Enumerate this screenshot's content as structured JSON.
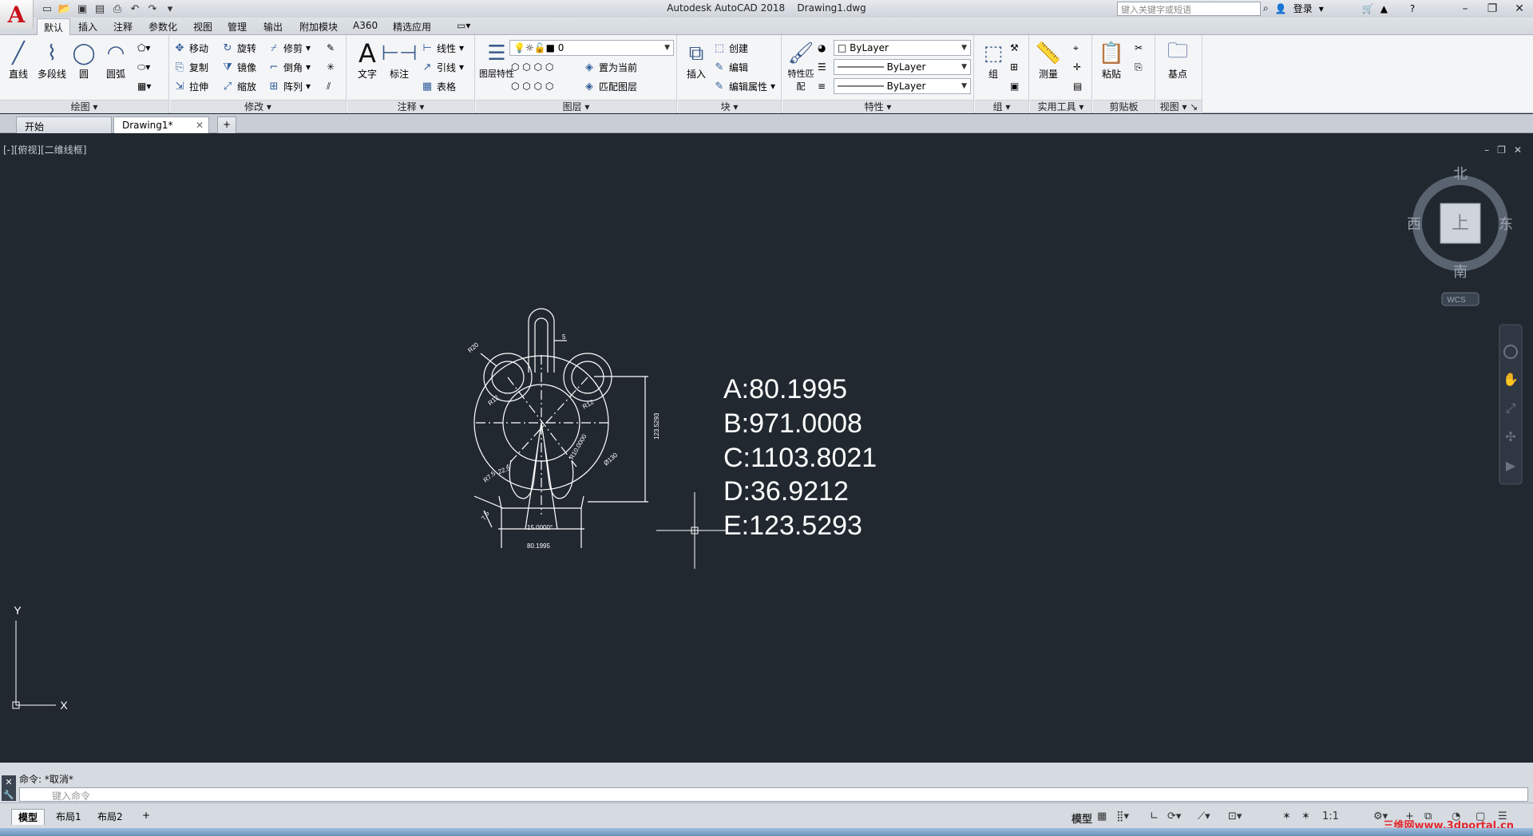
{
  "app": {
    "title": "Autodesk AutoCAD 2018",
    "filename": "Drawing1.dwg",
    "logo": "A",
    "search_placeholder": "键入关键字或短语",
    "login": "登录"
  },
  "ribbon_tabs": [
    "默认",
    "插入",
    "注释",
    "参数化",
    "视图",
    "管理",
    "输出",
    "附加模块",
    "A360",
    "精选应用"
  ],
  "panels": {
    "draw": {
      "title": "绘图",
      "tools": [
        "直线",
        "多段线",
        "圆",
        "圆弧"
      ]
    },
    "modify": {
      "title": "修改",
      "tools": [
        "移动",
        "旋转",
        "修剪",
        "复制",
        "镜像",
        "倒角",
        "拉伸",
        "缩放",
        "阵列"
      ]
    },
    "annotate": {
      "title": "注释",
      "tools": [
        "文字",
        "标注",
        "线性",
        "引线",
        "表格"
      ]
    },
    "layers": {
      "title": "图层",
      "tools": [
        "图层特性",
        "置为当前",
        "匹配图层"
      ],
      "current_layer": "0"
    },
    "block": {
      "title": "块",
      "tools": [
        "插入",
        "创建",
        "编辑",
        "编辑属性"
      ]
    },
    "properties": {
      "title": "特性",
      "tools": [
        "特性匹配"
      ],
      "color": "ByLayer",
      "linetype": "ByLayer",
      "lineweight": "ByLayer"
    },
    "groups": {
      "title": "组",
      "tools": [
        "组"
      ]
    },
    "utilities": {
      "title": "实用工具",
      "tools": [
        "测量"
      ]
    },
    "clipboard": {
      "title": "剪贴板",
      "tools": [
        "粘贴"
      ]
    },
    "view": {
      "title": "视图",
      "tools": [
        "基点"
      ]
    }
  },
  "file_tabs": [
    "开始",
    "Drawing1*"
  ],
  "viewport_label": "[-][俯视][二维线框]",
  "viewcube": {
    "north": "北",
    "south": "南",
    "east": "东",
    "west": "西",
    "top": "上",
    "wcs": "WCS"
  },
  "results": [
    "A:80.1995",
    "B:971.0008",
    "C:1103.8021",
    "D:36.9212",
    "E:123.5293"
  ],
  "dims": {
    "r20": "R20",
    "r12a": "R12",
    "r12b": "R12",
    "five": "5",
    "d130": "Ø130",
    "r10": "R10.0000",
    "v225": "22.5",
    "r75": "R7.5",
    "seventyfive": "7.5",
    "angle": "15.0000°",
    "width": "80.1995",
    "height": "123.5293"
  },
  "ucs": {
    "x": "X",
    "y": "Y"
  },
  "command": {
    "history": "命令: *取消*",
    "placeholder": "键入命令"
  },
  "layout_tabs": [
    "模型",
    "布局1",
    "布局2"
  ],
  "status": {
    "model": "模型",
    "scale": "1:1"
  },
  "watermark": "三维网www.3dportal.cn",
  "colors": {
    "canvas": "#212830",
    "line": "#ffffff",
    "ribbon": "#f4f5f7"
  }
}
